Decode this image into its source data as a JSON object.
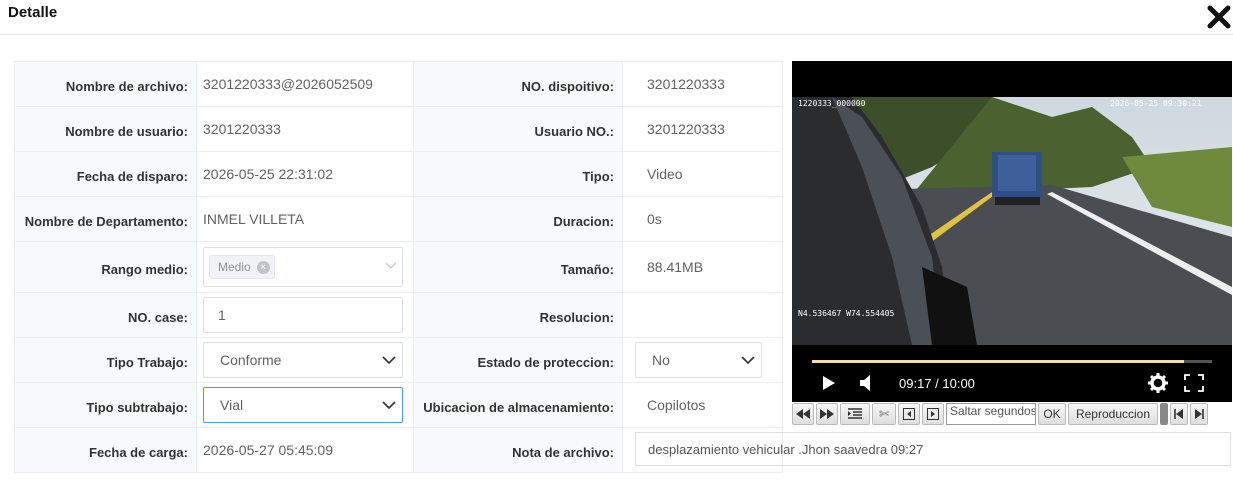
{
  "dialog": {
    "title": "Detalle"
  },
  "fields": {
    "nombre_archivo": {
      "label": "Nombre de archivo:",
      "value": "3201220333@2026052509"
    },
    "no_dispositivo": {
      "label": "NO. dispoitivo:",
      "value": "3201220333"
    },
    "nombre_usuario": {
      "label": "Nombre de usuario:",
      "value": "3201220333"
    },
    "usuario_no": {
      "label": "Usuario NO.:",
      "value": "3201220333"
    },
    "fecha_disparo": {
      "label": "Fecha de disparo:",
      "value": "2026-05-25 22:31:02"
    },
    "tipo": {
      "label": "Tipo:",
      "value": "Video"
    },
    "departamento": {
      "label": "Nombre de Departamento:",
      "value": "INMEL VILLETA"
    },
    "duracion": {
      "label": "Duracion:",
      "value": "0s"
    },
    "rango_medio": {
      "label": "Rango medio:",
      "tag": "Medio"
    },
    "tamano": {
      "label": "Tamaño:",
      "value": "88.41MB"
    },
    "no_case": {
      "label": "NO. case:",
      "value": "1"
    },
    "resolucion": {
      "label": "Resolucion:",
      "value": ""
    },
    "tipo_trabajo": {
      "label": "Tipo Trabajo:",
      "value": "Conforme"
    },
    "estado_proteccion": {
      "label": "Estado de proteccion:",
      "value": "No"
    },
    "tipo_subtrabajo": {
      "label": "Tipo subtrabajo:",
      "value": "Vial"
    },
    "ubicacion": {
      "label": "Ubicacion de almacenamiento:",
      "value": "Copilotos"
    },
    "fecha_carga": {
      "label": "Fecha de carga:",
      "value": "2026-05-27 05:45:09"
    },
    "nota_archivo": {
      "label": "Nota de archivo:",
      "value": "desplazamiento vehicular .Jhon saavedra 09:27"
    }
  },
  "player": {
    "osd_device": "1220333_000000",
    "osd_datetime": "2026-05-25 09:30:21",
    "osd_coords": "N4.536467 W74.554405",
    "timecode": "09:17 / 10:00",
    "progress": 0.93
  },
  "toolbar": {
    "seek_placeholder": "Saltar segundos",
    "ok_label": "OK",
    "playback_label": "Reproduccion"
  },
  "colors": {
    "accent": "#409eff",
    "progress": "#f0ddb0"
  }
}
